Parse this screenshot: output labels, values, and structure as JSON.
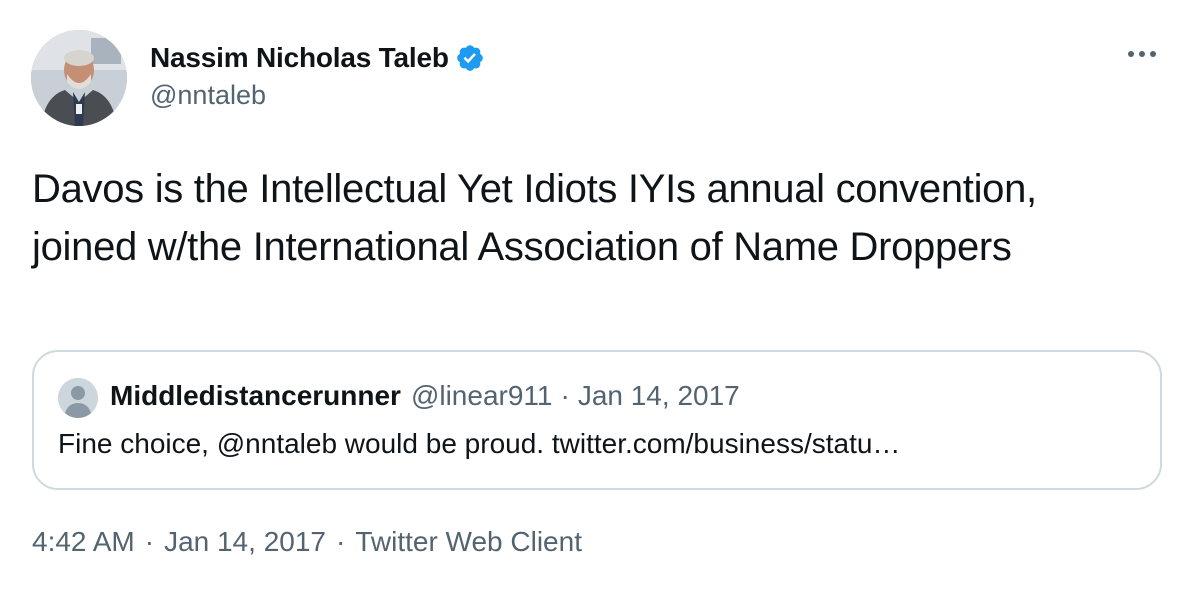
{
  "author": {
    "display_name": "Nassim Nicholas Taleb",
    "handle": "@nntaleb",
    "verified": true,
    "verified_color": "#1d9bf0"
  },
  "tweet": {
    "text": "Davos is the Intellectual Yet Idiots IYIs annual convention, joined w/the International Association of Name Droppers"
  },
  "quoted_tweet": {
    "display_name": "Middledistancerunner",
    "handle": "@linear911",
    "separator": "·",
    "date": "Jan 14, 2017",
    "text": "Fine choice, @nntaleb would be proud. twitter.com/business/statu…"
  },
  "meta": {
    "time": "4:42 AM",
    "separator": "·",
    "date": "Jan 14, 2017",
    "client": "Twitter Web Client"
  },
  "icons": {
    "more": "more-horizontal-icon",
    "verified": "verified-badge-icon",
    "avatar": "profile-photo",
    "quote_avatar": "default-profile-icon"
  },
  "colors": {
    "text_primary": "#0f1419",
    "text_secondary": "#536471",
    "border": "#cfd9de"
  }
}
